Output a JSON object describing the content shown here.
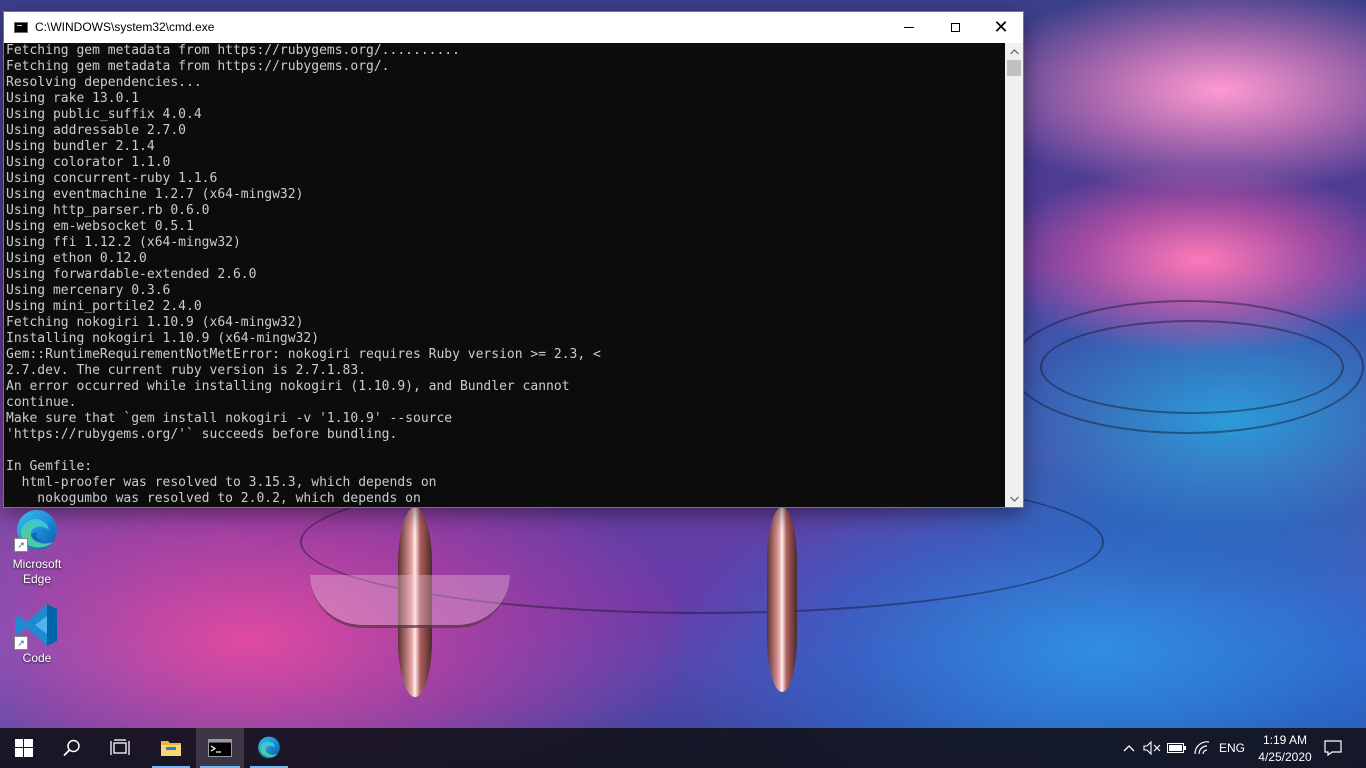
{
  "window": {
    "title": "C:\\WINDOWS\\system32\\cmd.exe",
    "minimize_label": "",
    "maximize_label": "",
    "close_label": "✕"
  },
  "console": {
    "lines": [
      "Fetching gem metadata from https://rubygems.org/..........",
      "Fetching gem metadata from https://rubygems.org/.",
      "Resolving dependencies...",
      "Using rake 13.0.1",
      "Using public_suffix 4.0.4",
      "Using addressable 2.7.0",
      "Using bundler 2.1.4",
      "Using colorator 1.1.0",
      "Using concurrent-ruby 1.1.6",
      "Using eventmachine 1.2.7 (x64-mingw32)",
      "Using http_parser.rb 0.6.0",
      "Using em-websocket 0.5.1",
      "Using ffi 1.12.2 (x64-mingw32)",
      "Using ethon 0.12.0",
      "Using forwardable-extended 2.6.0",
      "Using mercenary 0.3.6",
      "Using mini_portile2 2.4.0",
      "Fetching nokogiri 1.10.9 (x64-mingw32)",
      "Installing nokogiri 1.10.9 (x64-mingw32)",
      "Gem::RuntimeRequirementNotMetError: nokogiri requires Ruby version >= 2.3, <",
      "2.7.dev. The current ruby version is 2.7.1.83.",
      "An error occurred while installing nokogiri (1.10.9), and Bundler cannot",
      "continue.",
      "Make sure that `gem install nokogiri -v '1.10.9' --source",
      "'https://rubygems.org/'` succeeds before bundling.",
      "",
      "In Gemfile:",
      "  html-proofer was resolved to 3.15.3, which depends on",
      "    nokogumbo was resolved to 2.0.2, which depends on"
    ]
  },
  "desktop": {
    "icons": [
      {
        "label_line1": "Microsoft",
        "label_line2": "Edge",
        "icon": "edge-icon"
      },
      {
        "label_line1": "Code",
        "label_line2": "",
        "icon": "vscode-icon"
      }
    ]
  },
  "taskbar": {
    "items": [
      "start-icon",
      "search-icon",
      "task-view-icon",
      "file-explorer-icon",
      "cmd-icon",
      "edge-icon"
    ],
    "tray": {
      "language": "ENG",
      "time": "1:19 AM",
      "date": "4/25/2020"
    }
  },
  "colors": {
    "console_bg": "#0c0c0c",
    "console_fg": "#cccccc",
    "taskbar_bg": "#12121c",
    "accent": "#76b9ed"
  }
}
